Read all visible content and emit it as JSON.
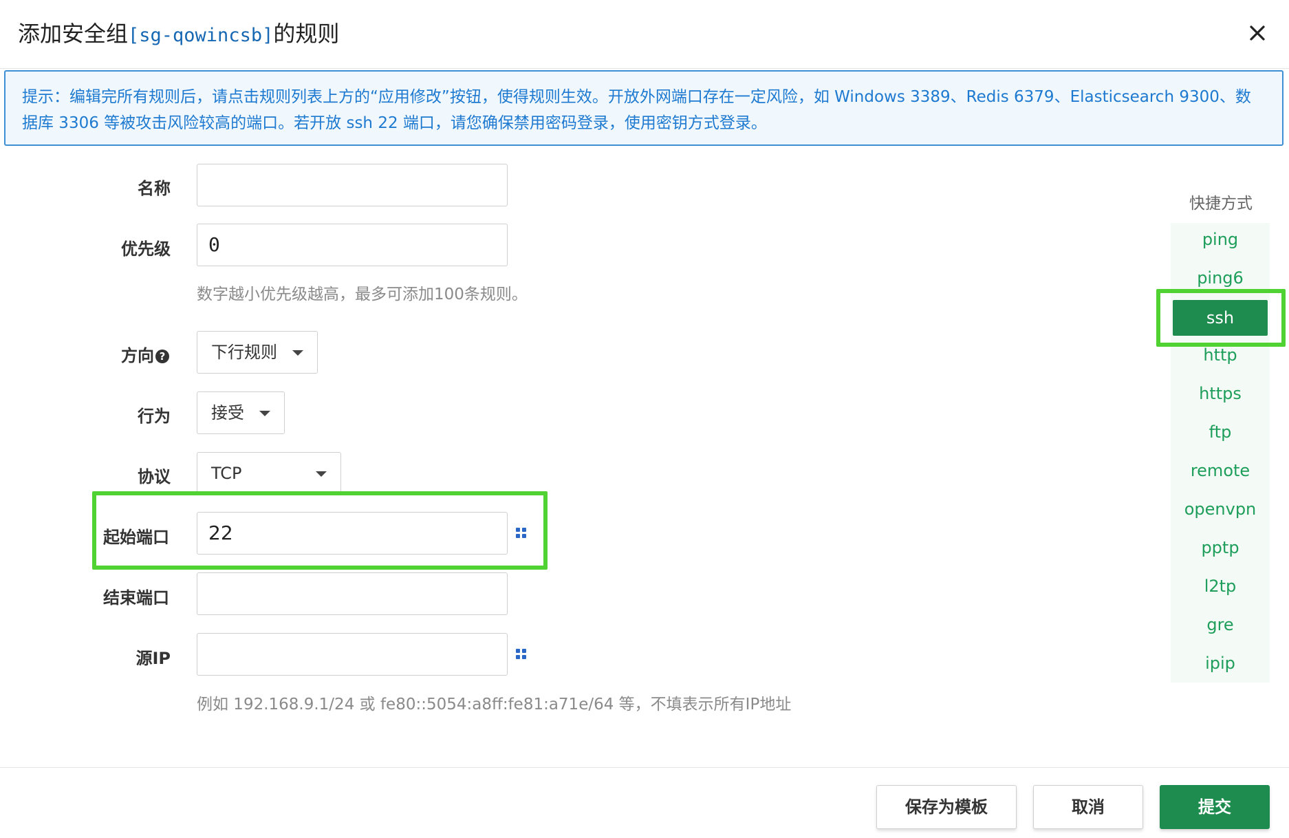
{
  "dialog": {
    "title_prefix": "添加安全组",
    "sg_name": "[sg-qowincsb]",
    "title_suffix": "的规则"
  },
  "notice": {
    "text": "提示：编辑完所有规则后，请点击规则列表上方的“应用修改”按钮，使得规则生效。开放外网端口存在一定风险，如 Windows 3389、Redis 6379、Elasticsearch 9300、数据库 3306 等被攻击风险较高的端口。若开放 ssh 22 端口，请您确保禁用密码登录，使用密钥方式登录。"
  },
  "form": {
    "name": {
      "label": "名称",
      "value": ""
    },
    "priority": {
      "label": "优先级",
      "value": "0",
      "hint": "数字越小优先级越高，最多可添加100条规则。"
    },
    "direction": {
      "label": "方向",
      "help_glyph": "?",
      "value": "下行规则"
    },
    "action": {
      "label": "行为",
      "value": "接受"
    },
    "protocol": {
      "label": "协议",
      "value": "TCP"
    },
    "start_port": {
      "label": "起始端口",
      "value": "22"
    },
    "end_port": {
      "label": "结束端口",
      "value": ""
    },
    "source_ip": {
      "label": "源IP",
      "value": "",
      "hint": "例如 192.168.9.1/24 或 fe80::5054:a8ff:fe81:a71e/64 等，不填表示所有IP地址"
    }
  },
  "shortcuts": {
    "title": "快捷方式",
    "active": "ssh",
    "items": [
      "ping",
      "ping6",
      "ssh",
      "http",
      "https",
      "ftp",
      "remote",
      "openvpn",
      "pptp",
      "l2tp",
      "gre",
      "ipip"
    ]
  },
  "footer": {
    "save_template_label": "保存为模板",
    "cancel_label": "取消",
    "submit_label": "提交"
  },
  "colors": {
    "primary_green": "#1f8c4f",
    "link_green": "#1e9e5a",
    "notice_blue": "#1e7ad0",
    "highlight_green": "#4fd232"
  },
  "icons": {
    "close": "close-icon",
    "help": "question-circle-icon",
    "grid": "grid-icon",
    "caret": "chevron-down-icon"
  }
}
